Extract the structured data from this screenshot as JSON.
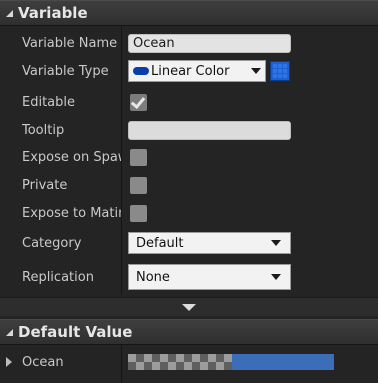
{
  "variable_section": {
    "title": "Variable"
  },
  "rows": {
    "variable_name": {
      "label": "Variable Name",
      "value": "Ocean"
    },
    "variable_type": {
      "label": "Variable Type",
      "value": "Linear Color",
      "pill_color": "#0b3fa8",
      "container_color": "#1f5fd0"
    },
    "editable": {
      "label": "Editable",
      "checked": true
    },
    "tooltip": {
      "label": "Tooltip",
      "value": ""
    },
    "expose_on_spawn": {
      "label": "Expose on Spawn",
      "checked": false
    },
    "private": {
      "label": "Private",
      "checked": false
    },
    "expose_to_matinee": {
      "label": "Expose to Matinee",
      "checked": false
    },
    "category": {
      "label": "Category",
      "value": "Default"
    },
    "replication": {
      "label": "Replication",
      "value": "None"
    }
  },
  "default_value_section": {
    "title": "Default Value"
  },
  "default_value": {
    "label": "Ocean",
    "color": "#3b6db8"
  }
}
